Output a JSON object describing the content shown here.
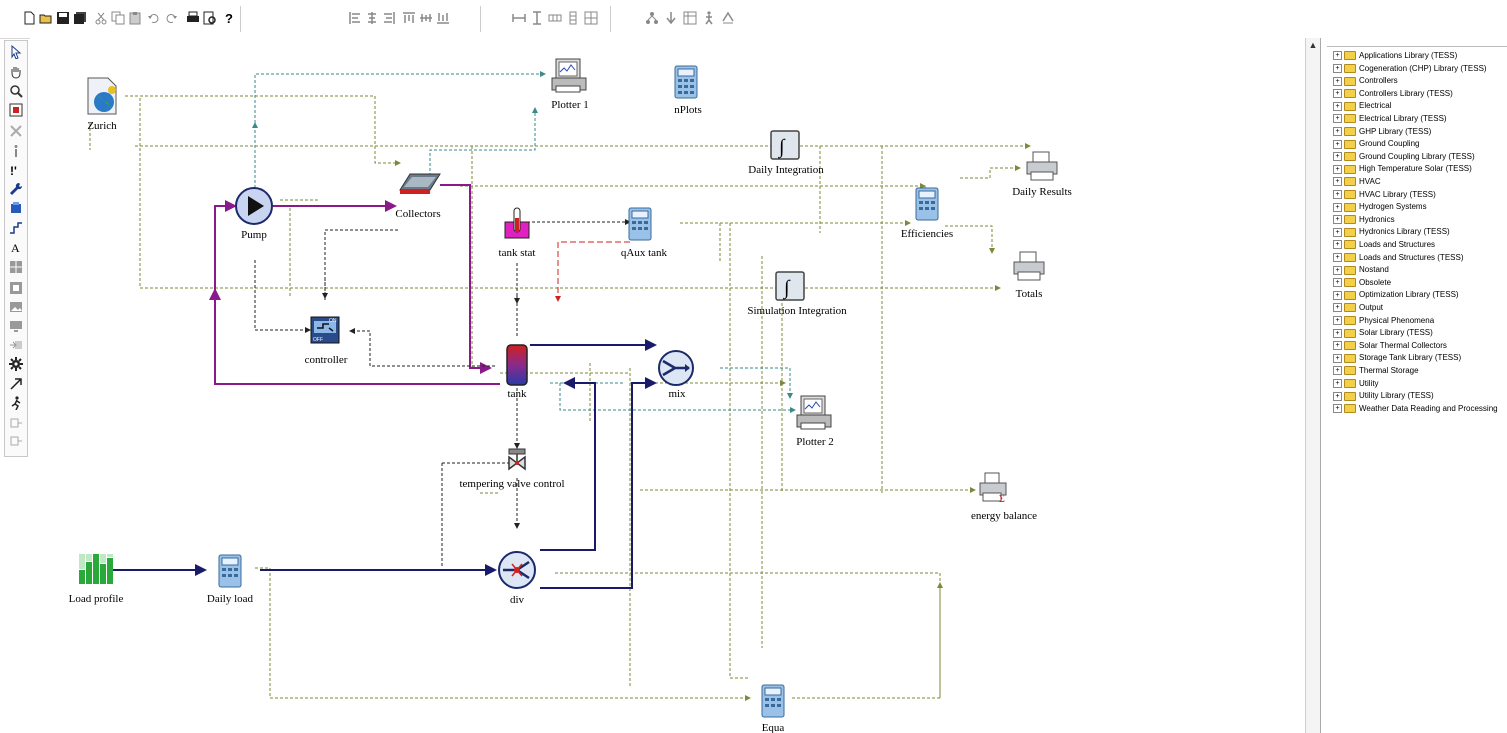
{
  "library_tree": [
    "Applications Library (TESS)",
    "Cogeneration (CHP) Library (TESS)",
    "Controllers",
    "Controllers Library (TESS)",
    "Electrical",
    "Electrical Library (TESS)",
    "GHP Library (TESS)",
    "Ground Coupling",
    "Ground Coupling Library (TESS)",
    "High Temperature Solar (TESS)",
    "HVAC",
    "HVAC Library (TESS)",
    "Hydrogen Systems",
    "Hydronics",
    "Hydronics Library (TESS)",
    "Loads and Structures",
    "Loads and Structures (TESS)",
    "Nostand",
    "Obsolete",
    "Optimization Library (TESS)",
    "Output",
    "Physical Phenomena",
    "Solar Library (TESS)",
    "Solar Thermal Collectors",
    "Storage Tank Library (TESS)",
    "Thermal Storage",
    "Utility",
    "Utility Library (TESS)",
    "Weather Data Reading and Processing"
  ],
  "nodes": {
    "zurich": "Zurich",
    "plotter1": "Plotter 1",
    "nplots": "nPlots",
    "daily_integration": "Daily Integration",
    "daily_results": "Daily Results",
    "collectors": "Collectors",
    "pump": "Pump",
    "tank_stat": "tank stat",
    "qaux_tank": "qAux tank",
    "efficiencies": "Efficiencies",
    "totals": "Totals",
    "simulation_integration": "Simulation Integration",
    "controller": "controller",
    "tank": "tank",
    "mix": "mix",
    "plotter2": "Plotter 2",
    "tempering_valve": "tempering valve control",
    "energy_balance": "energy balance",
    "load_profile": "Load profile",
    "daily_load": "Daily load",
    "div": "div",
    "equa": "Equa"
  },
  "colors": {
    "olive": "#7b8a3a",
    "teal": "#3a8a8a",
    "purple": "#8a1a8a",
    "navy": "#1a1a6a",
    "black": "#222222",
    "red": "#d02020"
  }
}
